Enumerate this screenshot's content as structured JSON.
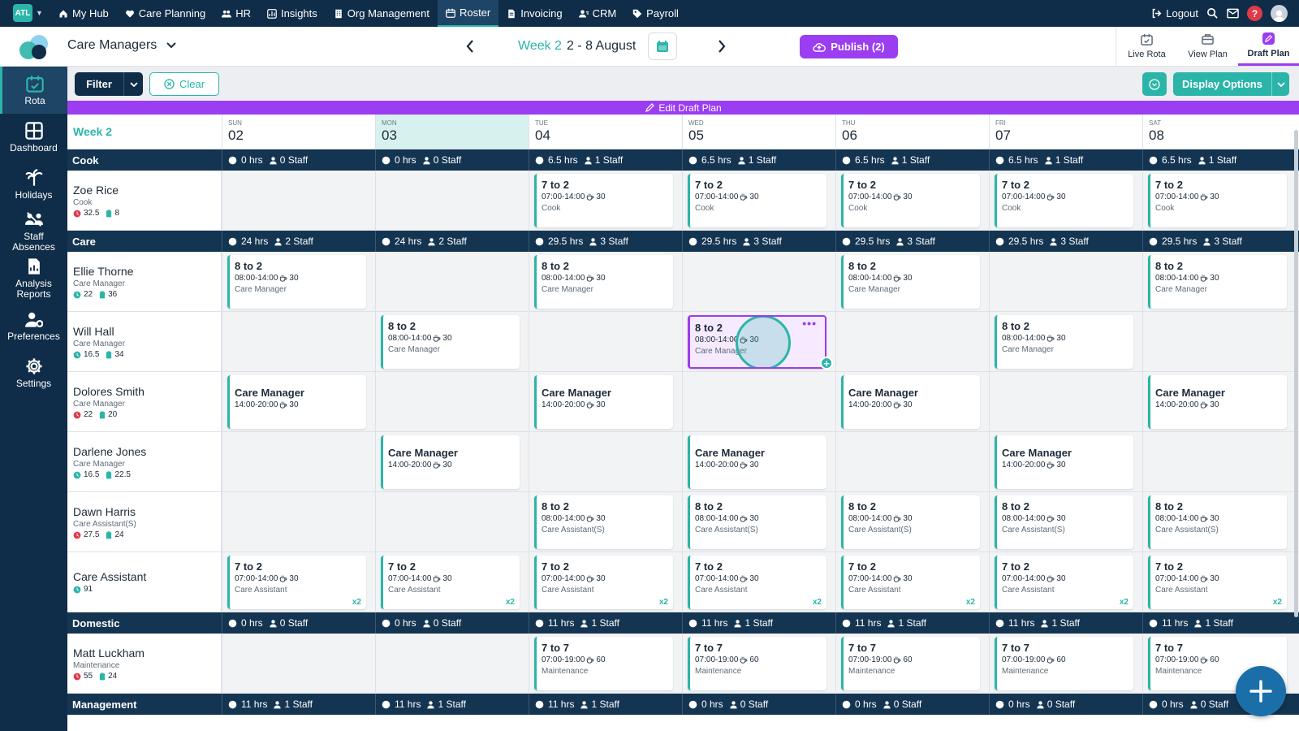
{
  "topnav": {
    "brand": "ATL",
    "items": [
      {
        "label": "My Hub",
        "icon": "home-icon"
      },
      {
        "label": "Care Planning",
        "icon": "heart-icon"
      },
      {
        "label": "HR",
        "icon": "people-icon"
      },
      {
        "label": "Insights",
        "icon": "chart-icon"
      },
      {
        "label": "Org Management",
        "icon": "building-icon"
      },
      {
        "label": "Roster",
        "icon": "calendar-icon",
        "active": true
      },
      {
        "label": "Invoicing",
        "icon": "document-icon"
      },
      {
        "label": "CRM",
        "icon": "contacts-icon"
      },
      {
        "label": "Payroll",
        "icon": "tag-icon"
      }
    ],
    "logout": "Logout",
    "help": "?"
  },
  "header": {
    "title": "Care Managers",
    "week_label": "Week 2",
    "date_range": "2 - 8 August",
    "publish": "Publish (2)",
    "views": [
      {
        "label": "Live Rota",
        "icon": "calendar-check-icon"
      },
      {
        "label": "View Plan",
        "icon": "briefcase-icon"
      },
      {
        "label": "Draft Plan",
        "icon": "pencil-icon",
        "active": true
      }
    ]
  },
  "sidebar": [
    {
      "label": "Rota",
      "icon": "calendar-check-icon",
      "active": true
    },
    {
      "label": "Dashboard",
      "icon": "dashboard-icon"
    },
    {
      "label": "Holidays",
      "icon": "palm-tree-icon"
    },
    {
      "label": "Staff Absences",
      "icon": "people-absent-icon"
    },
    {
      "label": "Analysis Reports",
      "icon": "report-icon"
    },
    {
      "label": "Preferences",
      "icon": "user-settings-icon"
    },
    {
      "label": "Settings",
      "icon": "gear-icon"
    }
  ],
  "toolbar": {
    "filter": "Filter",
    "clear": "Clear",
    "display_options": "Display Options"
  },
  "draft_banner": "Edit Draft Plan",
  "grid": {
    "week_label": "Week 2",
    "days": [
      {
        "name": "SUN",
        "date": "02"
      },
      {
        "name": "MON",
        "date": "03",
        "today": true
      },
      {
        "name": "TUE",
        "date": "04"
      },
      {
        "name": "WED",
        "date": "05"
      },
      {
        "name": "THU",
        "date": "06"
      },
      {
        "name": "FRI",
        "date": "07"
      },
      {
        "name": "SAT",
        "date": "08"
      }
    ],
    "sections": [
      {
        "name": "Cook",
        "totals": [
          [
            "0 hrs",
            "0 Staff"
          ],
          [
            "0 hrs",
            "0 Staff"
          ],
          [
            "6.5 hrs",
            "1 Staff"
          ],
          [
            "6.5 hrs",
            "1 Staff"
          ],
          [
            "6.5 hrs",
            "1 Staff"
          ],
          [
            "6.5 hrs",
            "1 Staff"
          ],
          [
            "6.5 hrs",
            "1 Staff"
          ]
        ],
        "people": [
          {
            "name": "Zoe Rice",
            "role": "Cook",
            "stat_a": "32.5",
            "stat_b": "8",
            "stat_color": "#e03a4a",
            "shifts": [
              null,
              null,
              {
                "title": "7 to 2",
                "time": "07:00-14:00",
                "brk": "30",
                "role": "Cook"
              },
              {
                "title": "7 to 2",
                "time": "07:00-14:00",
                "brk": "30",
                "role": "Cook"
              },
              {
                "title": "7 to 2",
                "time": "07:00-14:00",
                "brk": "30",
                "role": "Cook"
              },
              {
                "title": "7 to 2",
                "time": "07:00-14:00",
                "brk": "30",
                "role": "Cook"
              },
              {
                "title": "7 to 2",
                "time": "07:00-14:00",
                "brk": "30",
                "role": "Cook"
              }
            ]
          }
        ]
      },
      {
        "name": "Care",
        "totals": [
          [
            "24 hrs",
            "2 Staff"
          ],
          [
            "24 hrs",
            "2 Staff"
          ],
          [
            "29.5 hrs",
            "3 Staff"
          ],
          [
            "29.5 hrs",
            "3 Staff"
          ],
          [
            "29.5 hrs",
            "3 Staff"
          ],
          [
            "29.5 hrs",
            "3 Staff"
          ],
          [
            "29.5 hrs",
            "3 Staff"
          ]
        ],
        "people": [
          {
            "name": "Ellie Thorne",
            "role": "Care Manager",
            "stat_a": "22",
            "stat_b": "36",
            "stat_color": "#2bb5a8",
            "shifts": [
              {
                "title": "8 to 2",
                "time": "08:00-14:00",
                "brk": "30",
                "role": "Care Manager"
              },
              null,
              {
                "title": "8 to 2",
                "time": "08:00-14:00",
                "brk": "30",
                "role": "Care Manager"
              },
              null,
              {
                "title": "8 to 2",
                "time": "08:00-14:00",
                "brk": "30",
                "role": "Care Manager"
              },
              null,
              {
                "title": "8 to 2",
                "time": "08:00-14:00",
                "brk": "30",
                "role": "Care Manager"
              }
            ]
          },
          {
            "name": "Will Hall",
            "role": "Care Manager",
            "stat_a": "16.5",
            "stat_b": "34",
            "stat_color": "#2bb5a8",
            "shifts": [
              null,
              {
                "title": "8 to 2",
                "time": "08:00-14:00",
                "brk": "30",
                "role": "Care Manager"
              },
              null,
              {
                "title": "8 to 2",
                "time": "08:00-14:00",
                "brk": "30",
                "role": "Care Manager",
                "selected": true
              },
              null,
              {
                "title": "8 to 2",
                "time": "08:00-14:00",
                "brk": "30",
                "role": "Care Manager"
              },
              null
            ]
          },
          {
            "name": "Dolores Smith",
            "role": "Care Manager",
            "stat_a": "22",
            "stat_b": "20",
            "stat_color": "#e03a4a",
            "shifts": [
              {
                "title": "Care Manager",
                "time": "14:00-20:00",
                "brk": "30",
                "compact": true
              },
              null,
              {
                "title": "Care Manager",
                "time": "14:00-20:00",
                "brk": "30",
                "compact": true
              },
              null,
              {
                "title": "Care Manager",
                "time": "14:00-20:00",
                "brk": "30",
                "compact": true
              },
              null,
              {
                "title": "Care Manager",
                "time": "14:00-20:00",
                "brk": "30",
                "compact": true
              }
            ]
          },
          {
            "name": "Darlene Jones",
            "role": "Care Manager",
            "stat_a": "16.5",
            "stat_b": "22.5",
            "stat_color": "#2bb5a8",
            "shifts": [
              null,
              {
                "title": "Care Manager",
                "time": "14:00-20:00",
                "brk": "30",
                "compact": true
              },
              null,
              {
                "title": "Care Manager",
                "time": "14:00-20:00",
                "brk": "30",
                "compact": true
              },
              null,
              {
                "title": "Care Manager",
                "time": "14:00-20:00",
                "brk": "30",
                "compact": true
              },
              null
            ]
          },
          {
            "name": "Dawn Harris",
            "role": "Care Assistant(S)",
            "stat_a": "27.5",
            "stat_b": "24",
            "stat_color": "#e03a4a",
            "shifts": [
              null,
              null,
              {
                "title": "8 to 2",
                "time": "08:00-14:00",
                "brk": "30",
                "role": "Care Assistant(S)"
              },
              {
                "title": "8 to 2",
                "time": "08:00-14:00",
                "brk": "30",
                "role": "Care Assistant(S)"
              },
              {
                "title": "8 to 2",
                "time": "08:00-14:00",
                "brk": "30",
                "role": "Care Assistant(S)"
              },
              {
                "title": "8 to 2",
                "time": "08:00-14:00",
                "brk": "30",
                "role": "Care Assistant(S)"
              },
              {
                "title": "8 to 2",
                "time": "08:00-14:00",
                "brk": "30",
                "role": "Care Assistant(S)"
              }
            ]
          },
          {
            "name": "Care Assistant",
            "role": "",
            "stat_a": "91",
            "stat_b": "",
            "stat_color": "#2bb5a8",
            "shifts": [
              {
                "title": "7 to 2",
                "time": "07:00-14:00",
                "brk": "30",
                "role": "Care Assistant",
                "count": "x2"
              },
              {
                "title": "7 to 2",
                "time": "07:00-14:00",
                "brk": "30",
                "role": "Care Assistant",
                "count": "x2"
              },
              {
                "title": "7 to 2",
                "time": "07:00-14:00",
                "brk": "30",
                "role": "Care Assistant",
                "count": "x2"
              },
              {
                "title": "7 to 2",
                "time": "07:00-14:00",
                "brk": "30",
                "role": "Care Assistant",
                "count": "x2"
              },
              {
                "title": "7 to 2",
                "time": "07:00-14:00",
                "brk": "30",
                "role": "Care Assistant",
                "count": "x2"
              },
              {
                "title": "7 to 2",
                "time": "07:00-14:00",
                "brk": "30",
                "role": "Care Assistant",
                "count": "x2"
              },
              {
                "title": "7 to 2",
                "time": "07:00-14:00",
                "brk": "30",
                "role": "Care Assistant",
                "count": "x2"
              }
            ]
          }
        ]
      },
      {
        "name": "Domestic",
        "totals": [
          [
            "0 hrs",
            "0 Staff"
          ],
          [
            "0 hrs",
            "0 Staff"
          ],
          [
            "11 hrs",
            "1 Staff"
          ],
          [
            "11 hrs",
            "1 Staff"
          ],
          [
            "11 hrs",
            "1 Staff"
          ],
          [
            "11 hrs",
            "1 Staff"
          ],
          [
            "11 hrs",
            "1 Staff"
          ]
        ],
        "people": [
          {
            "name": "Matt Luckham",
            "role": "Maintenance",
            "stat_a": "55",
            "stat_b": "24",
            "stat_color": "#e03a4a",
            "shifts": [
              null,
              null,
              {
                "title": "7 to 7",
                "time": "07:00-19:00",
                "brk": "60",
                "role": "Maintenance"
              },
              {
                "title": "7 to 7",
                "time": "07:00-19:00",
                "brk": "60",
                "role": "Maintenance"
              },
              {
                "title": "7 to 7",
                "time": "07:00-19:00",
                "brk": "60",
                "role": "Maintenance"
              },
              {
                "title": "7 to 7",
                "time": "07:00-19:00",
                "brk": "60",
                "role": "Maintenance"
              },
              {
                "title": "7 to 7",
                "time": "07:00-19:00",
                "brk": "60",
                "role": "Maintenance"
              }
            ]
          }
        ]
      },
      {
        "name": "Management",
        "totals": [
          [
            "11 hrs",
            "1 Staff"
          ],
          [
            "11 hrs",
            "1 Staff"
          ],
          [
            "11 hrs",
            "1 Staff"
          ],
          [
            "0 hrs",
            "0 Staff"
          ],
          [
            "0 hrs",
            "0 Staff"
          ],
          [
            "0 hrs",
            "0 Staff"
          ],
          [
            "0 hrs",
            "0 Staff"
          ]
        ],
        "people": []
      }
    ]
  },
  "colors": {
    "navy": "#0f2d48",
    "teal": "#2bb5a8",
    "purple": "#9b3df0",
    "red": "#e03a4a"
  }
}
